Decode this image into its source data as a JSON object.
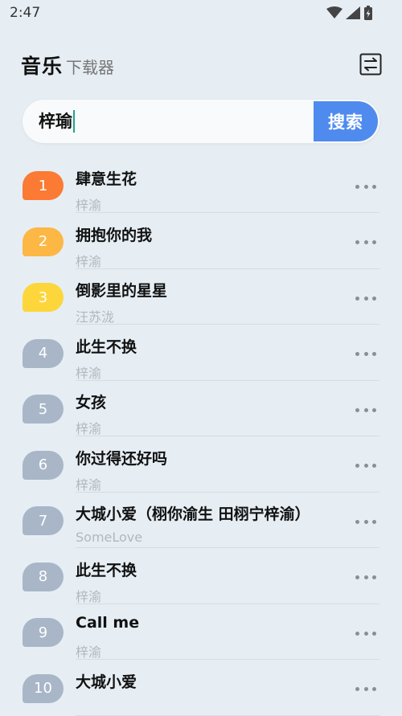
{
  "status_bar": {
    "time": "2:47"
  },
  "header": {
    "title": "音乐",
    "subtitle": "下载器"
  },
  "search": {
    "query": "梓瑜",
    "button_label": "搜索"
  },
  "colors": {
    "rank1": "#fb7a34",
    "rank2": "#fdb745",
    "rank3": "#fdd63c",
    "rank_default": "#a8b6c8",
    "accent": "#4f8bef"
  },
  "songs": [
    {
      "rank": "1",
      "title": "肆意生花",
      "artist": "梓渝"
    },
    {
      "rank": "2",
      "title": "拥抱你的我",
      "artist": "梓渝"
    },
    {
      "rank": "3",
      "title": "倒影里的星星",
      "artist": "汪苏泷"
    },
    {
      "rank": "4",
      "title": "此生不换",
      "artist": "梓渝"
    },
    {
      "rank": "5",
      "title": "女孩",
      "artist": "梓渝"
    },
    {
      "rank": "6",
      "title": "你过得还好吗",
      "artist": "梓渝"
    },
    {
      "rank": "7",
      "title": "大城小爱（栩你渝生 田栩宁梓渝）",
      "artist": "SomeLove"
    },
    {
      "rank": "8",
      "title": "此生不换",
      "artist": "梓渝"
    },
    {
      "rank": "9",
      "title": "Call me",
      "artist": "梓渝"
    },
    {
      "rank": "10",
      "title": "大城小爱",
      "artist": ""
    }
  ]
}
